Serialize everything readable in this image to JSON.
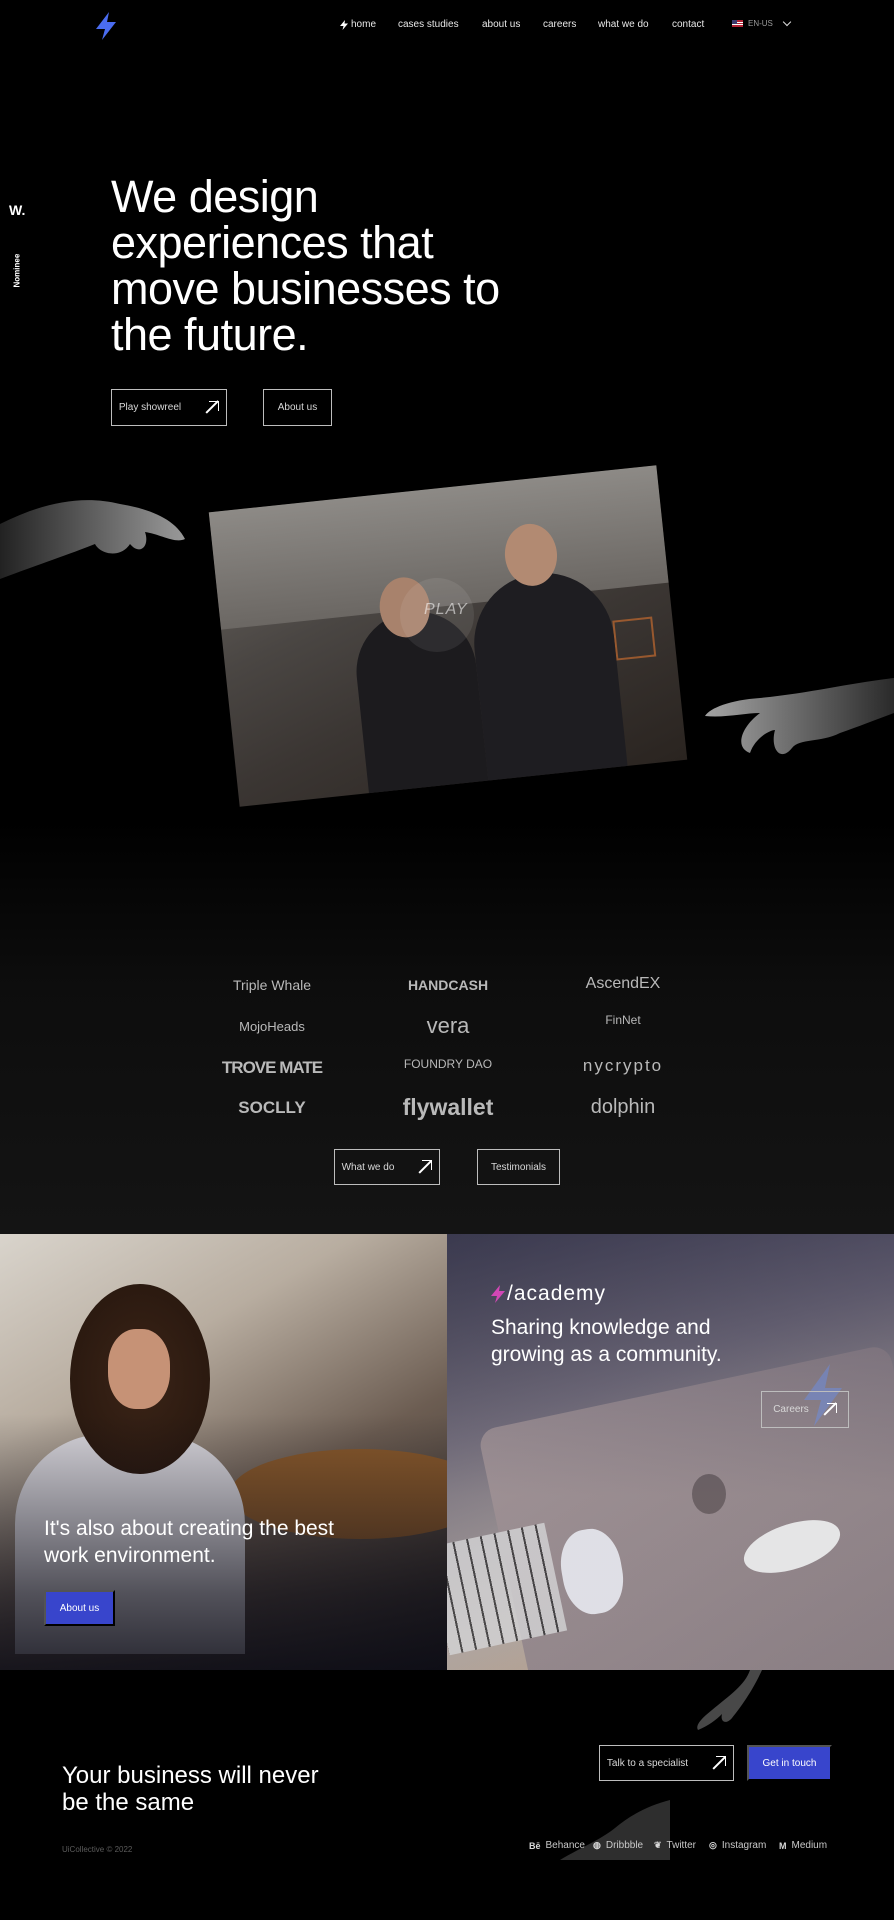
{
  "nav": {
    "items": [
      "home",
      "cases studies",
      "about us",
      "careers",
      "what we do",
      "contact"
    ],
    "language": "EN-US"
  },
  "side_badge": {
    "mark": "W.",
    "label": "Nominee"
  },
  "hero": {
    "title": "We design experiences that move businesses to the future.",
    "play_showreel_label": "Play showreel",
    "about_us_label": "About us",
    "play_label": "PLAY"
  },
  "clients": [
    "Triple Whale",
    "HANDCASH",
    "AscendEX",
    "MojoHeads",
    "vera",
    "FinNet",
    "TROVE MATE",
    "FOUNDRY DAO",
    "nycrypto",
    "SOCLLY",
    "flywallet",
    "dolphin"
  ],
  "clients_buttons": {
    "what_we_do_label": "What we do",
    "testimonials_label": "Testimonials"
  },
  "environment": {
    "text": "It's also about creating the best work environment.",
    "button_label": "About us"
  },
  "academy": {
    "tag": "/academy",
    "text": "Sharing knowledge and growing as a community.",
    "button_label": "Careers"
  },
  "footer": {
    "title": "Your business will never be the same",
    "talk_label": "Talk to a specialist",
    "get_in_touch_label": "Get in touch",
    "copyright": "UiCollective © 2022",
    "social": [
      "Behance",
      "Dribbble",
      "Twitter",
      "Instagram",
      "Medium"
    ]
  },
  "colors": {
    "accent": "#3845cc",
    "background": "#000000",
    "academy_bolt": "#d247b5"
  }
}
